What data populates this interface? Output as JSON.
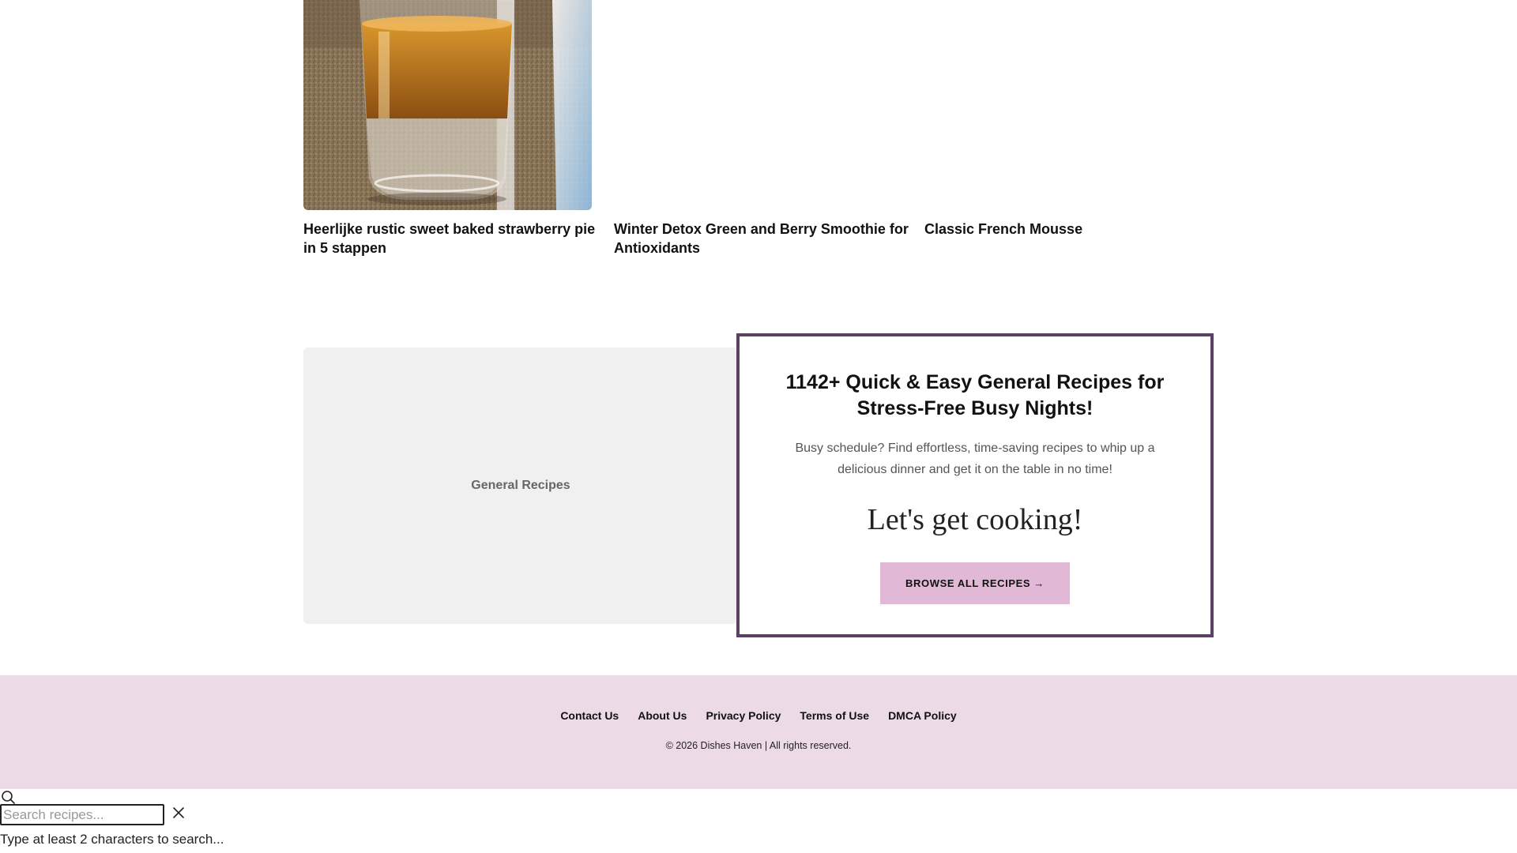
{
  "recipes": [
    {
      "title": "Heerlijke rustic sweet baked strawberry pie in 5 stappen",
      "image": "glass-of-amber-drink"
    },
    {
      "title": "Winter Detox Green and Berry Smoothie for Antioxidants",
      "image": ""
    },
    {
      "title": "Classic French Mousse",
      "image": ""
    }
  ],
  "category": {
    "label": "General Recipes"
  },
  "promo": {
    "title": "1142+ Quick & Easy General Recipes for Stress-Free Busy Nights!",
    "description": "Busy schedule? Find effortless, time-saving recipes to whip up a delicious dinner and get it on the table in no time!",
    "cta_heading": "Let's get cooking!",
    "button_label": "BROWSE ALL RECIPES →"
  },
  "footer": {
    "links": [
      "Contact Us",
      "About Us",
      "Privacy Policy",
      "Terms of Use",
      "DMCA Policy"
    ],
    "copyright": "© 2026 Dishes Haven | All rights reserved."
  },
  "search": {
    "placeholder": "Search recipes...",
    "value": "",
    "hint": "Type at least 2 characters to search...",
    "icons": {
      "search": "search-icon",
      "close": "close-icon"
    }
  },
  "colors": {
    "promo_border": "#5b4164",
    "button_bg": "#e1b8d6",
    "footer_bg": "#ecdbe6",
    "category_bg": "#f0f0f0"
  }
}
